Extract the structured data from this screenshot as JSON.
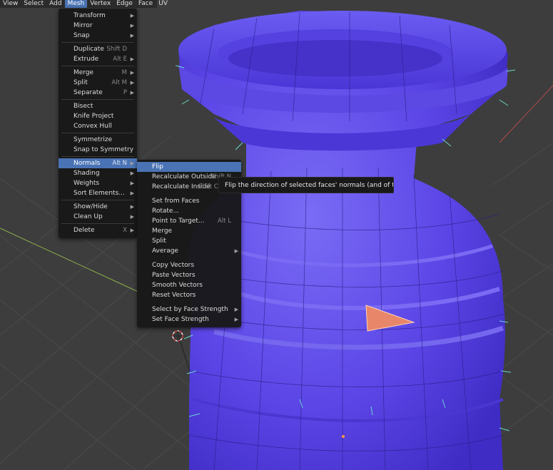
{
  "menubar": [
    {
      "label": "View",
      "active": false
    },
    {
      "label": "Select",
      "active": false
    },
    {
      "label": "Add",
      "active": false
    },
    {
      "label": "Mesh",
      "active": true
    },
    {
      "label": "Vertex",
      "active": false
    },
    {
      "label": "Edge",
      "active": false
    },
    {
      "label": "Face",
      "active": false
    },
    {
      "label": "UV",
      "active": false
    }
  ],
  "mesh_menu": [
    {
      "label": "Transform",
      "shortcut": "",
      "submenu": true
    },
    {
      "label": "Mirror",
      "shortcut": "",
      "submenu": true
    },
    {
      "label": "Snap",
      "shortcut": "",
      "submenu": true
    },
    {
      "sep": true
    },
    {
      "label": "Duplicate",
      "shortcut": "Shift D",
      "submenu": false
    },
    {
      "label": "Extrude",
      "shortcut": "Alt E",
      "submenu": true
    },
    {
      "sep": true
    },
    {
      "label": "Merge",
      "shortcut": "M",
      "submenu": true
    },
    {
      "label": "Split",
      "shortcut": "Alt M",
      "submenu": true
    },
    {
      "label": "Separate",
      "shortcut": "P",
      "submenu": true
    },
    {
      "sep": true
    },
    {
      "label": "Bisect",
      "shortcut": "",
      "submenu": false
    },
    {
      "label": "Knife Project",
      "shortcut": "",
      "submenu": false
    },
    {
      "label": "Convex Hull",
      "shortcut": "",
      "submenu": false
    },
    {
      "sep": true
    },
    {
      "label": "Symmetrize",
      "shortcut": "",
      "submenu": false
    },
    {
      "label": "Snap to Symmetry",
      "shortcut": "",
      "submenu": false
    },
    {
      "sep": true
    },
    {
      "label": "Normals",
      "shortcut": "Alt N",
      "submenu": true,
      "highlighted": true
    },
    {
      "label": "Shading",
      "shortcut": "",
      "submenu": true
    },
    {
      "label": "Weights",
      "shortcut": "",
      "submenu": true
    },
    {
      "label": "Sort Elements...",
      "shortcut": "",
      "submenu": true
    },
    {
      "sep": true
    },
    {
      "label": "Show/Hide",
      "shortcut": "",
      "submenu": true
    },
    {
      "label": "Clean Up",
      "shortcut": "",
      "submenu": true
    },
    {
      "sep": true
    },
    {
      "label": "Delete",
      "shortcut": "X",
      "submenu": true
    }
  ],
  "normals_menu": [
    {
      "label": "Flip",
      "shortcut": "",
      "submenu": false,
      "highlighted": true
    },
    {
      "label": "Recalculate Outside",
      "shortcut": "Shift N",
      "submenu": false
    },
    {
      "label": "Recalculate Inside",
      "shortcut": "Shift Ctrl N",
      "submenu": false
    },
    {
      "gap": true
    },
    {
      "label": "Set from Faces",
      "shortcut": "",
      "submenu": false
    },
    {
      "label": "Rotate...",
      "shortcut": "",
      "submenu": false
    },
    {
      "label": "Point to Target...",
      "shortcut": "Alt L",
      "submenu": false
    },
    {
      "label": "Merge",
      "shortcut": "",
      "submenu": false
    },
    {
      "label": "Split",
      "shortcut": "",
      "submenu": false
    },
    {
      "label": "Average",
      "shortcut": "",
      "submenu": true
    },
    {
      "gap": true
    },
    {
      "label": "Copy Vectors",
      "shortcut": "",
      "submenu": false
    },
    {
      "label": "Paste Vectors",
      "shortcut": "",
      "submenu": false
    },
    {
      "label": "Smooth Vectors",
      "shortcut": "",
      "submenu": false
    },
    {
      "label": "Reset Vectors",
      "shortcut": "",
      "submenu": false
    },
    {
      "gap": true
    },
    {
      "label": "Select by Face Strength",
      "shortcut": "",
      "submenu": true
    },
    {
      "label": "Set Face Strength",
      "shortcut": "",
      "submenu": true
    }
  ],
  "tooltip": "Flip the direction of selected faces' normals (and of their vertices).",
  "colors": {
    "mesh": "#5f49e6",
    "normals": "#5fe0d0",
    "selected_face": "#e8866a",
    "highlight": "#4a73b5"
  }
}
